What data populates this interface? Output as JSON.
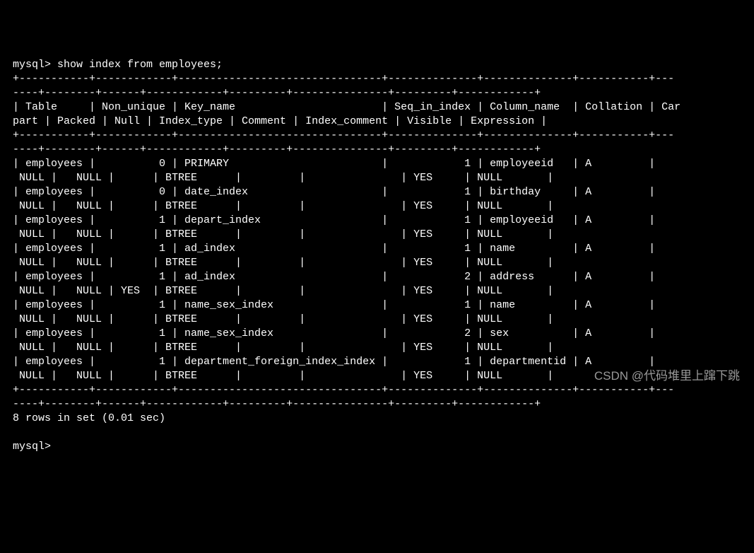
{
  "prompt1": "mysql> ",
  "command": "show index from employees;",
  "border_top": "+-----------+------------+--------------------------------+--------------+--------------+-----------+---",
  "border_wrap": "----+--------+------+------------+---------+---------------+---------+------------+",
  "header_line1": "| Table     | Non_unique | Key_name                       | Seq_in_index | Column_name  | Collation | Car",
  "header_line2": "part | Packed | Null | Index_type | Comment | Index_comment | Visible | Expression |",
  "rows": [
    {
      "l1": "| employees |          0 | PRIMARY                        |            1 | employeeid   | A         |",
      "l2": " NULL |   NULL |      | BTREE      |         |               | YES     | NULL       |"
    },
    {
      "l1": "| employees |          0 | date_index                     |            1 | birthday     | A         |",
      "l2": " NULL |   NULL |      | BTREE      |         |               | YES     | NULL       |"
    },
    {
      "l1": "| employees |          1 | depart_index                   |            1 | employeeid   | A         |",
      "l2": " NULL |   NULL |      | BTREE      |         |               | YES     | NULL       |"
    },
    {
      "l1": "| employees |          1 | ad_index                       |            1 | name         | A         |",
      "l2": " NULL |   NULL |      | BTREE      |         |               | YES     | NULL       |"
    },
    {
      "l1": "| employees |          1 | ad_index                       |            2 | address      | A         |",
      "l2": " NULL |   NULL | YES  | BTREE      |         |               | YES     | NULL       |"
    },
    {
      "l1": "| employees |          1 | name_sex_index                 |            1 | name         | A         |",
      "l2": " NULL |   NULL |      | BTREE      |         |               | YES     | NULL       |"
    },
    {
      "l1": "| employees |          1 | name_sex_index                 |            2 | sex          | A         |",
      "l2": " NULL |   NULL |      | BTREE      |         |               | YES     | NULL       |"
    },
    {
      "l1": "| employees |          1 | department_foreign_index_index |            1 | departmentid | A         |",
      "l2": " NULL |   NULL |      | BTREE      |         |               | YES     | NULL       |"
    }
  ],
  "footer": "8 rows in set (0.01 sec)",
  "prompt2": "mysql>",
  "watermark": "CSDN @代码堆里上蹿下跳"
}
